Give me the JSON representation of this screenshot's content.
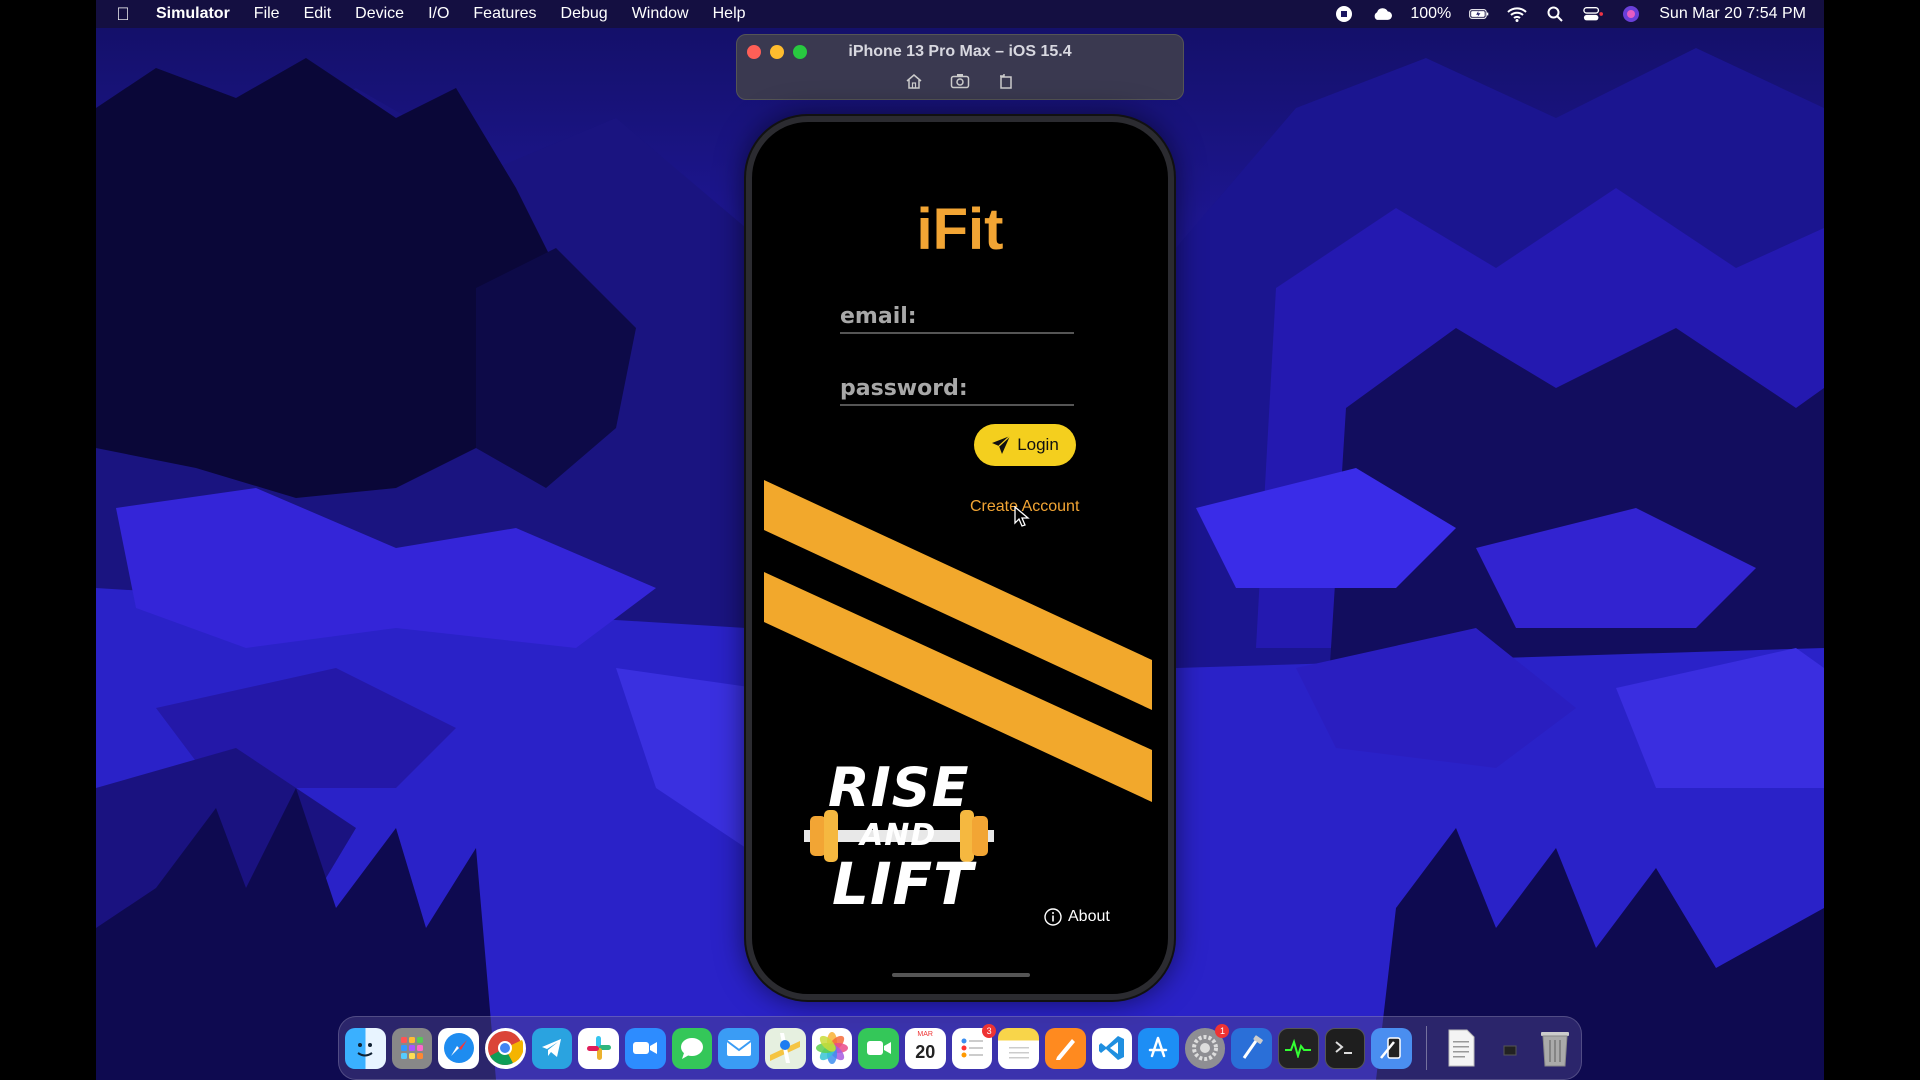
{
  "menubar": {
    "app_name": "Simulator",
    "items": [
      "File",
      "Edit",
      "Device",
      "I/O",
      "Features",
      "Debug",
      "Window",
      "Help"
    ],
    "battery": "100%",
    "clock": "Sun Mar 20  7:54 PM"
  },
  "simulator": {
    "title": "iPhone 13 Pro Max – iOS 15.4",
    "tools": [
      "home-icon",
      "screenshot-icon",
      "rotate-icon"
    ]
  },
  "app": {
    "title": "iFit",
    "email_placeholder": "email:",
    "password_placeholder": "password:",
    "login_label": "Login",
    "create_account_label": "Create Account",
    "logo": {
      "line1": "RISE",
      "line2": "AND",
      "line3": "LIFT"
    },
    "about_label": "About",
    "accent_color": "#f2a534",
    "button_color": "#f4cf1e"
  },
  "dock": {
    "calendar": {
      "month": "MAR",
      "day": "20"
    },
    "badges": {
      "reminders": "3",
      "system_settings": "1"
    }
  }
}
